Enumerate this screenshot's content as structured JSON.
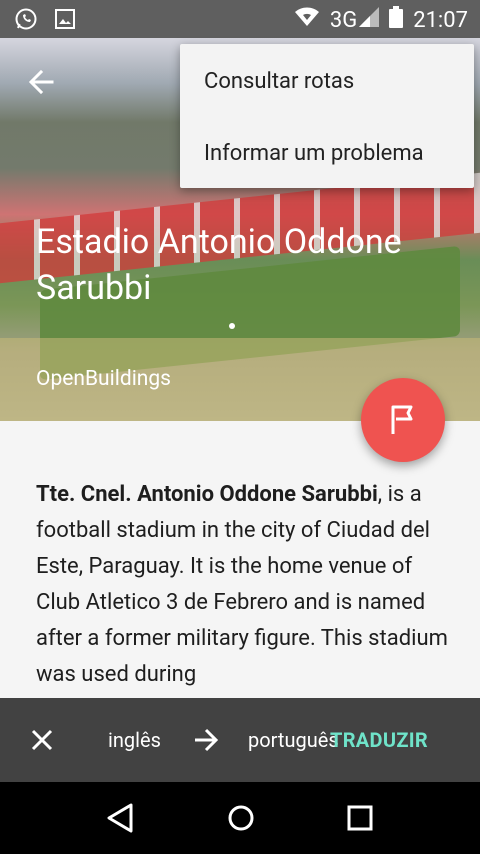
{
  "status_bar": {
    "network": "3G",
    "time": "21:07",
    "icons": [
      "whatsapp-icon",
      "image-icon",
      "wifi-icon",
      "signal-icon",
      "battery-icon"
    ]
  },
  "header": {
    "back_icon": "arrow-back-icon",
    "title": "Estadio Antonio Oddone Sarubbi",
    "subtitle": "OpenBuildings"
  },
  "menu": {
    "items": [
      "Consultar rotas",
      "Informar um problema"
    ]
  },
  "fab": {
    "icon": "flag-icon",
    "color": "#ef5350"
  },
  "article": {
    "bold_lead": "Tte. Cnel. Antonio Oddone Sarubbi",
    "body": ", is a football stadium in the city of Ciudad del Este, Paraguay. It is the home venue of Club Atletico 3 de Febrero and is named after a former military figure. This stadium was used during"
  },
  "translate_bar": {
    "from_lang": "inglês",
    "to_lang": "português",
    "action": "TRADUZIR",
    "action_color": "#6fe3c9"
  },
  "nav_bar": {
    "icons": [
      "back-icon",
      "home-icon",
      "recents-icon"
    ]
  }
}
